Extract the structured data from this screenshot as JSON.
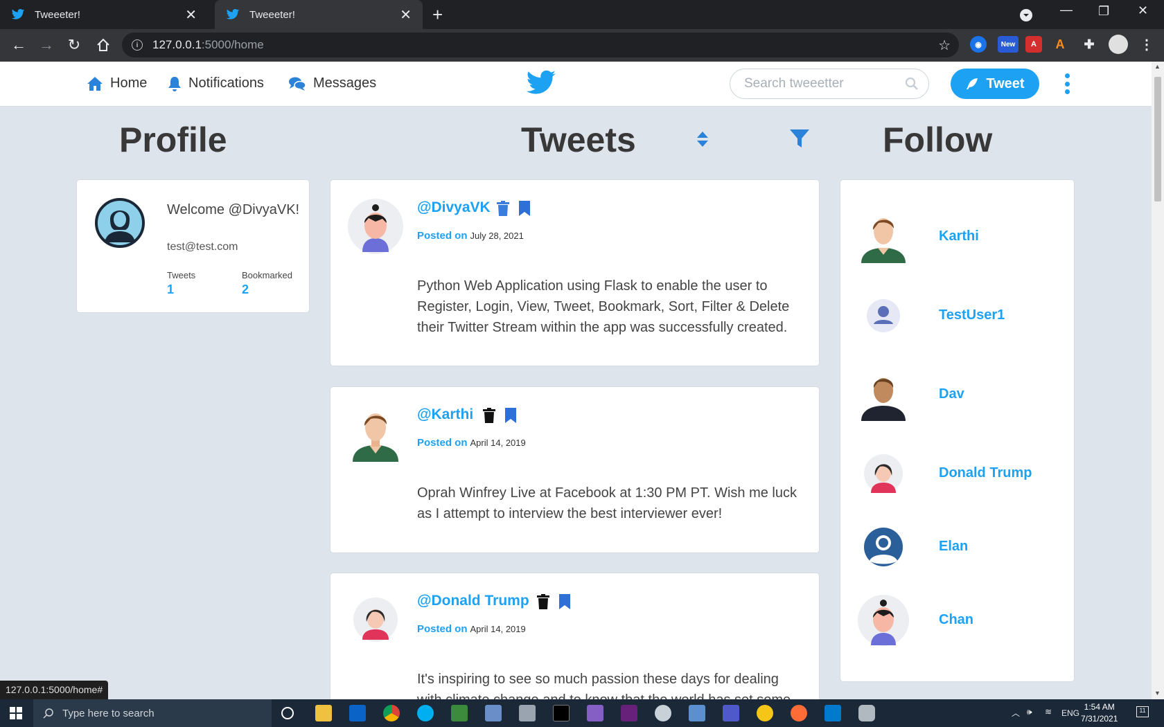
{
  "browser": {
    "tabs": [
      {
        "title": "Tweeeter!",
        "active": false
      },
      {
        "title": "Tweeeter!",
        "active": true
      }
    ],
    "url_host": "127.0.0.1",
    "url_path": ":5000/home",
    "ext_new_badge": "New"
  },
  "nav": {
    "home": "Home",
    "notifications": "Notifications",
    "messages": "Messages",
    "search_placeholder": "Search tweeetter",
    "tweet_button": "Tweet"
  },
  "sections": {
    "profile": "Profile",
    "tweets": "Tweets",
    "follow": "Follow"
  },
  "profile": {
    "welcome": "Welcome @DivyaVK!",
    "email": "test@test.com",
    "tweets_label": "Tweets",
    "tweets_count": "1",
    "bookmarked_label": "Bookmarked",
    "bookmarked_count": "2"
  },
  "tweets": [
    {
      "handle": "@DivyaVK",
      "posted_label": "Posted on",
      "date": "July 28, 2021",
      "text": "Python Web Application using Flask to enable the user to Register, Login, View, Tweet, Bookmark, Sort, Filter & Delete their Twitter Stream within the app was successfully created.",
      "delete_color": "#3b7ddd"
    },
    {
      "handle": "@Karthi",
      "posted_label": "Posted on",
      "date": "April 14, 2019",
      "text": "Oprah Winfrey Live at Facebook at 1:30 PM PT. Wish me luck as I attempt to interview the best interviewer ever!",
      "delete_color": "#111111"
    },
    {
      "handle": "@Donald Trump",
      "posted_label": "Posted on",
      "date": "April 14, 2019",
      "text": "It's inspiring to see so much passion these days for dealing with climate change and to know that the world has set some",
      "delete_color": "#111111"
    }
  ],
  "follow": [
    {
      "name": "Karthi"
    },
    {
      "name": "TestUser1"
    },
    {
      "name": "Dav"
    },
    {
      "name": "Donald Trump"
    },
    {
      "name": "Elan"
    },
    {
      "name": "Chan"
    }
  ],
  "status_url": "127.0.0.1:5000/home#",
  "taskbar": {
    "search_placeholder": "Type here to search",
    "lang": "ENG",
    "time": "1:54 AM",
    "date": "7/31/2021",
    "notif_count": "11"
  },
  "colors": {
    "accent": "#1da1f2",
    "page_bg": "#dde4ec",
    "bookmark": "#2f6fd8"
  }
}
